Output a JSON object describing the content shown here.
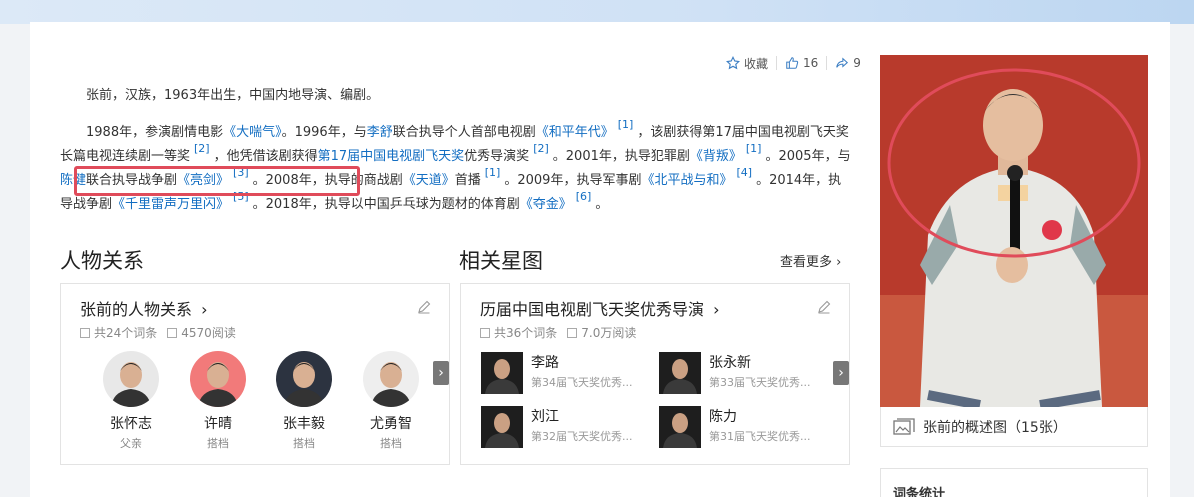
{
  "actions": {
    "favorite_label": "收藏",
    "like_count": "16",
    "share_count": "9"
  },
  "intro": {
    "p1": "张前，汉族，1963年出生，中国内地导演、编剧。",
    "p2": [
      {
        "t": "1988年，参演剧情电影"
      },
      {
        "t": "《大喘气》",
        "link": true
      },
      {
        "t": "。1996年，与"
      },
      {
        "t": "李舒",
        "link": true
      },
      {
        "t": "联合执导个人首部电视剧"
      },
      {
        "t": "《和平年代》",
        "link": true
      },
      {
        "t": "[1]",
        "sup": true
      },
      {
        "t": "，该剧获得第17届中国电视剧飞天奖长篇电视连续剧一等奖"
      },
      {
        "t": "[2]",
        "sup": true
      },
      {
        "t": "，他凭借该剧获得"
      },
      {
        "t": "第17届中国电视剧飞天奖",
        "link": true
      },
      {
        "t": "优秀导演奖"
      },
      {
        "t": "[2]",
        "sup": true
      },
      {
        "t": "。2001年，执导犯罪剧"
      },
      {
        "t": "《背叛》",
        "link": true
      },
      {
        "t": "[1]",
        "sup": true
      },
      {
        "t": "。2005年，与"
      },
      {
        "t": "陈健",
        "link": true
      },
      {
        "t": "联合执导战争剧"
      },
      {
        "t": "《亮剑》",
        "link": true
      },
      {
        "t": "[3]",
        "sup": true
      },
      {
        "t": "。2008年，执导的商战剧"
      },
      {
        "t": "《天道》",
        "link": true
      },
      {
        "t": "首播"
      },
      {
        "t": "[1]",
        "sup": true
      },
      {
        "t": "。2009年，执导军事剧"
      },
      {
        "t": "《北平战与和》",
        "link": true
      },
      {
        "t": "[4]",
        "sup": true
      },
      {
        "t": "。2014年，执导战争剧"
      },
      {
        "t": "《千里雷声万里闪》",
        "link": true
      },
      {
        "t": "[5]",
        "sup": true
      },
      {
        "t": "。2018年，执导以中国乒乓球为题材的体育剧"
      },
      {
        "t": "《夺金》",
        "link": true
      },
      {
        "t": "[6]",
        "sup": true
      },
      {
        "t": "。"
      }
    ]
  },
  "relations": {
    "section_title": "人物关系",
    "panel_title": "张前的人物关系",
    "chevron": "›",
    "entries_count": "共24个词条",
    "reads": "4570阅读",
    "people": [
      {
        "name": "张怀志",
        "role": "父亲",
        "bg": "#e8e8e8"
      },
      {
        "name": "许晴",
        "role": "搭档",
        "bg": "#f27a7a"
      },
      {
        "name": "张丰毅",
        "role": "搭档",
        "bg": "#2c3340"
      },
      {
        "name": "尤勇智",
        "role": "搭档",
        "bg": "#eeeeee"
      }
    ],
    "next_arrow": "›"
  },
  "stars": {
    "section_title": "相关星图",
    "more_label": "查看更多",
    "panel_title": "历届中国电视剧飞天奖优秀导演",
    "entries_count": "共36个词条",
    "reads": "7.0万阅读",
    "items": [
      {
        "name": "李路",
        "desc": "第34届飞天奖优秀..."
      },
      {
        "name": "张永新",
        "desc": "第33届飞天奖优秀..."
      },
      {
        "name": "刘江",
        "desc": "第32届飞天奖优秀..."
      },
      {
        "name": "陈力",
        "desc": "第31届飞天奖优秀..."
      }
    ],
    "next_arrow": "›"
  },
  "photo": {
    "caption": "张前的概述图（15张）"
  },
  "stats": {
    "title": "词条统计"
  },
  "colors": {
    "link": "#136ec2",
    "highlight": "#e04b5a"
  }
}
